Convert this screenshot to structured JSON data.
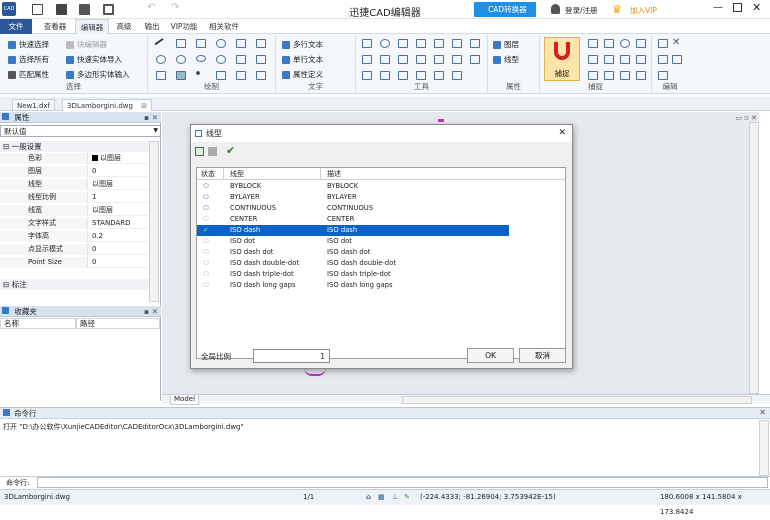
{
  "app": {
    "title": "迅捷CAD编辑器",
    "converter_label": "CAD转换器",
    "login_label": "登录/注册",
    "vip_label": "加入VIP"
  },
  "menu": {
    "tabs": [
      "文件",
      "查看器",
      "编辑器",
      "高级",
      "输出",
      "VIP功能",
      "相关软件"
    ]
  },
  "ribbon": {
    "select": {
      "label": "选择",
      "items": [
        "快速选择",
        "选择所有",
        "匹配属性",
        "块编辑器",
        "快速实体导入",
        "多边形实体输入"
      ]
    },
    "draw": {
      "label": "绘制"
    },
    "text": {
      "label": "文字",
      "items": [
        "多行文本",
        "单行文本",
        "属性定义"
      ]
    },
    "tools": {
      "label": "工具"
    },
    "props": {
      "label": "属性",
      "items": [
        "图层",
        "线型"
      ]
    },
    "snap": {
      "label": "捕捉",
      "button": "捕捉"
    },
    "edit": {
      "label": "编辑"
    }
  },
  "doctabs": [
    "New1.dxf",
    "3DLamborgini.dwg"
  ],
  "properties": {
    "title": "属性",
    "dropdown": "默认值",
    "section": "一般设置",
    "rows": [
      {
        "k": "色彩",
        "v": "以图层"
      },
      {
        "k": "图层",
        "v": "0"
      },
      {
        "k": "线型",
        "v": "以图层"
      },
      {
        "k": "线型比例",
        "v": "1"
      },
      {
        "k": "线宽",
        "v": "以图层"
      },
      {
        "k": "文字样式",
        "v": "STANDARD"
      },
      {
        "k": "字体高",
        "v": "0.2"
      },
      {
        "k": "点显示模式",
        "v": "0"
      },
      {
        "k": "Point Size",
        "v": "0"
      }
    ],
    "section2": "标注"
  },
  "favorites": {
    "title": "收藏夹",
    "col_name": "名称",
    "col_path": "路径"
  },
  "model_tab": "Model",
  "command": {
    "title": "命令行",
    "log": "打开 \"D:\\办公软件\\XunjieCADEditor\\CADEditorOcx\\3DLamborgini.dwg\"",
    "prompt": "命令行:"
  },
  "status": {
    "file": "3DLamborgini.dwg",
    "page": "1/1",
    "coords": "(-224.4333; -81.26904; 3.753942E-15)",
    "size": "180.6008 x 141.5804 x 173.8424"
  },
  "dialog": {
    "title": "线型",
    "columns": [
      "状态",
      "线型",
      "描述"
    ],
    "rows": [
      {
        "name": "BYBLOCK",
        "desc": "BYBLOCK"
      },
      {
        "name": "BYLAYER",
        "desc": "BYLAYER"
      },
      {
        "name": "CONTINUOUS",
        "desc": "CONTINUOUS"
      },
      {
        "name": "CENTER",
        "desc": "CENTER"
      },
      {
        "name": "ISO dash",
        "desc": "ISO dash"
      },
      {
        "name": "ISO dot",
        "desc": "ISO dot"
      },
      {
        "name": "ISO dash dot",
        "desc": "ISO dash dot"
      },
      {
        "name": "ISO dash double-dot",
        "desc": "ISO dash double-dot"
      },
      {
        "name": "ISO dash triple-dot",
        "desc": "ISO dash triple-dot"
      },
      {
        "name": "ISO dash long gaps",
        "desc": "ISO dash long gaps"
      }
    ],
    "selected_index": 4,
    "scale_label": "全局比例",
    "scale_value": "1",
    "ok": "OK",
    "cancel": "取消"
  },
  "colors": {
    "accent": "#2b5797",
    "selection": "#0a64c8",
    "canvas": "#e6e9ee"
  }
}
